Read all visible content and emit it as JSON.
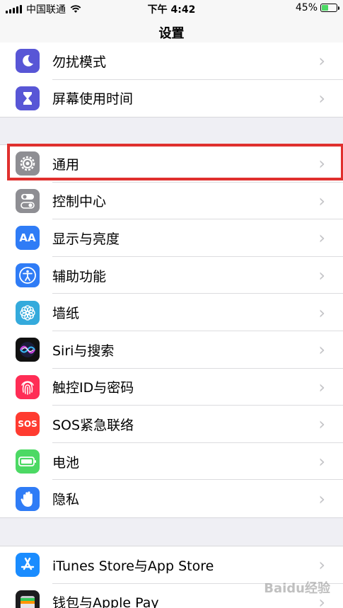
{
  "status_bar": {
    "carrier": "中国联通",
    "time": "下午 4:42",
    "battery": "45%"
  },
  "header": {
    "title": "设置"
  },
  "group1": [
    {
      "label": "勿扰模式",
      "icon": "moon-icon",
      "color": "#5856d6"
    },
    {
      "label": "屏幕使用时间",
      "icon": "hourglass-icon",
      "color": "#5856d6"
    }
  ],
  "group2": [
    {
      "label": "通用",
      "icon": "gear-icon",
      "color": "#8e8e93",
      "highlighted": true
    },
    {
      "label": "控制中心",
      "icon": "toggle-icon",
      "color": "#8e8e93"
    },
    {
      "label": "显示与亮度",
      "icon": "text-size-icon",
      "color": "#2f7cf6",
      "glyph": "AA"
    },
    {
      "label": "辅助功能",
      "icon": "accessibility-icon",
      "color": "#2f7cf6"
    },
    {
      "label": "墙纸",
      "icon": "flower-icon",
      "color": "#34aadc"
    },
    {
      "label": "Siri与搜索",
      "icon": "siri-icon",
      "color": "#111111"
    },
    {
      "label": "触控ID与密码",
      "icon": "fingerprint-icon",
      "color": "#ff2d55"
    },
    {
      "label": "SOS紧急联络",
      "icon": "sos-icon",
      "color": "#ff3b30",
      "glyph": "SOS"
    },
    {
      "label": "电池",
      "icon": "battery-icon",
      "color": "#4cd964"
    },
    {
      "label": "隐私",
      "icon": "hand-icon",
      "color": "#2f7cf6"
    }
  ],
  "group3": [
    {
      "label": "iTunes Store与App Store",
      "icon": "app-store-icon",
      "color": "#1a8cff"
    },
    {
      "label": "钱包与Apple Pay",
      "icon": "wallet-icon",
      "color": "#1c1c1e"
    }
  ],
  "watermark": "Baidu经验"
}
